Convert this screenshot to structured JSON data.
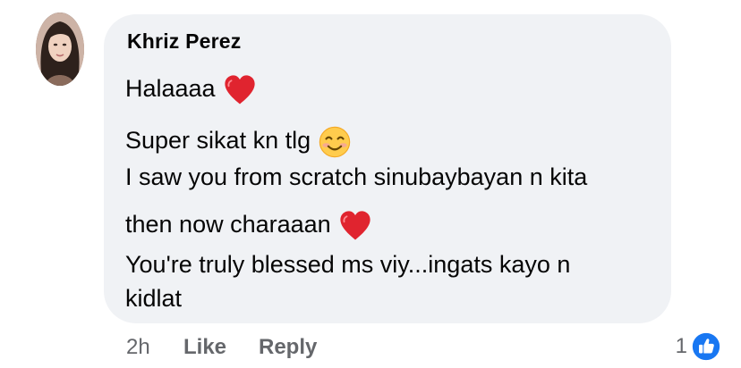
{
  "comment": {
    "author": "Khriz Perez",
    "lines": [
      {
        "text": "Halaaaa",
        "emoji": "heart-icon"
      },
      {
        "text": "Super sikat kn tlg",
        "emoji": "smiling-face-icon"
      },
      {
        "text": "I saw you from scratch sinubaybayan n kita",
        "emoji": ""
      },
      {
        "text": "then now charaaan",
        "emoji": "heart-icon"
      },
      {
        "text": "You're truly blessed ms viy...ingats kayo n",
        "emoji": ""
      },
      {
        "text": "kidlat",
        "emoji": ""
      }
    ],
    "timestamp": "2h",
    "like_label": "Like",
    "reply_label": "Reply",
    "reaction_count": "1",
    "reaction_icon": "thumbs-up-icon"
  },
  "colors": {
    "bubble": "#f0f2f5",
    "text": "#050505",
    "meta": "#65676b",
    "heart": "#e0242f",
    "like_blue": "#1877f2"
  }
}
